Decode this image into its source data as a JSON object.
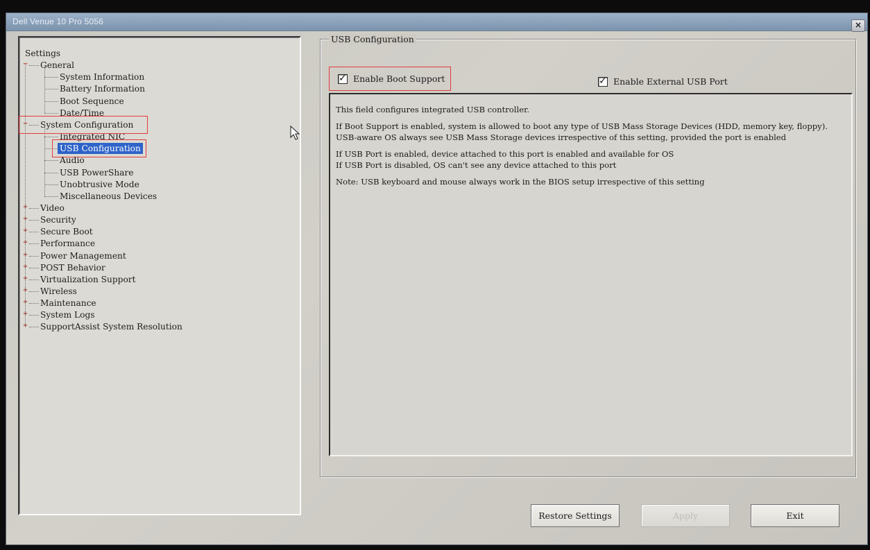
{
  "window": {
    "title": "Dell Venue 10 Pro 5056",
    "close_glyph": "×"
  },
  "tree": {
    "root": "Settings",
    "general": {
      "label": "General",
      "children": [
        "System Information",
        "Battery Information",
        "Boot Sequence",
        "Date/Time"
      ]
    },
    "system_configuration": {
      "label": "System Configuration",
      "children": [
        "Integrated NIC",
        "USB Configuration",
        "Audio",
        "USB PowerShare",
        "Unobtrusive Mode",
        "Miscellaneous Devices"
      ],
      "selected": "USB Configuration"
    },
    "collapsed_groups": [
      "Video",
      "Security",
      "Secure Boot",
      "Performance",
      "Power Management",
      "POST Behavior",
      "Virtualization Support",
      "Wireless",
      "Maintenance",
      "System Logs",
      "SupportAssist System Resolution"
    ],
    "expanded_glyph": "−",
    "collapsed_glyph": "+"
  },
  "usb_config": {
    "group_label": "USB Configuration",
    "enable_boot_support": {
      "label": "Enable Boot Support",
      "checked": true
    },
    "enable_external_usb_port": {
      "label": "Enable External USB Port",
      "checked": true
    },
    "check_glyph": "✓",
    "description": [
      "This field configures integrated USB controller.",
      "If Boot Support is enabled, system is allowed to boot any type of USB Mass Storage Devices (HDD, memory key, floppy).",
      "USB-aware OS always see USB Mass Storage devices irrespective of this setting, provided the port is enabled",
      "If USB Port is enabled, device attached to this port is enabled and available for OS",
      "If USB Port is disabled, OS can't see any device attached to this port",
      "Note: USB keyboard and mouse always work in the BIOS setup irrespective of this setting"
    ]
  },
  "buttons": {
    "restore": "Restore Settings",
    "apply": "Apply",
    "exit": "Exit"
  },
  "colors": {
    "highlight_box": "#e23b3b",
    "selection": "#2e63c8",
    "titlebar": "#8aa1ba"
  }
}
